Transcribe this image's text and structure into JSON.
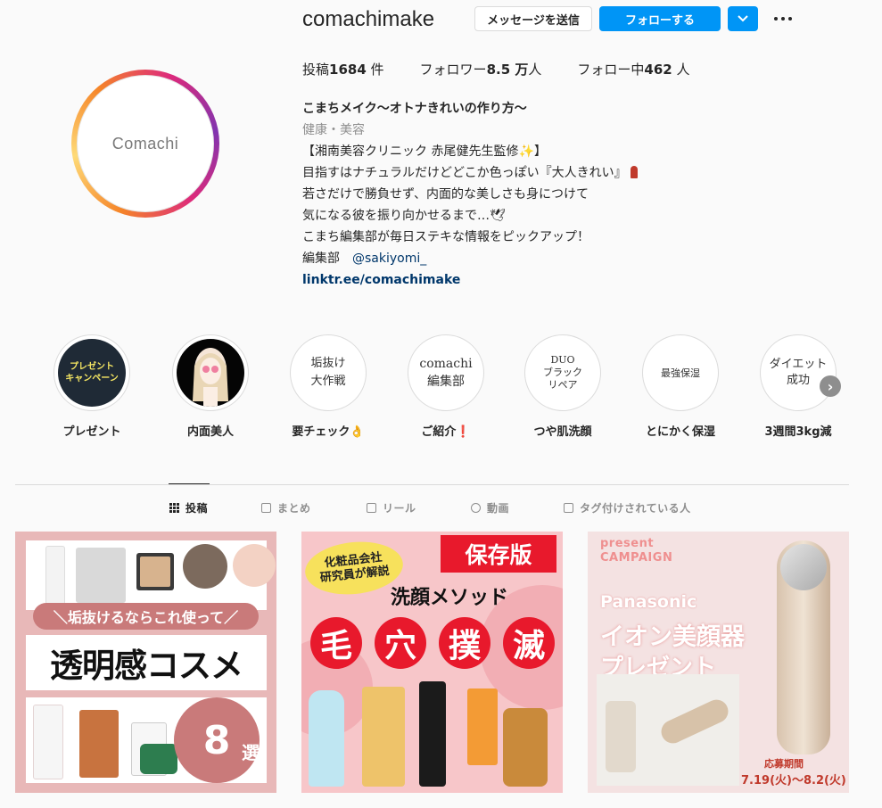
{
  "profile": {
    "username": "comachimake",
    "avatar_text": "Comachi",
    "message_button": "メッセージを送信",
    "follow_button": "フォローする",
    "stats": {
      "posts_label": "投稿",
      "posts_value": "1684",
      "posts_unit": " 件",
      "followers_label": "フォロワー",
      "followers_value": "8.5 万",
      "followers_unit": "人",
      "following_label": "フォロー中",
      "following_value": "462",
      "following_unit": " 人"
    },
    "bio": {
      "name": "こまちメイク〜オトナきれいの作り方〜",
      "category": "健康・美容",
      "line1": "【湘南美容クリニック 赤尾健先生監修",
      "line1_end": "】",
      "line2": "目指すはナチュラルだけどどこか色っぽい『大人きれい』",
      "line3": "若さだけで勝負せず、内面的な美しさも身につけて",
      "line4": "気になる彼を振り向かせるまで…🕊",
      "line5": "こまち編集部が毎日ステキな情報をピックアップ！",
      "line6_prefix": "編集部",
      "mention": "@sakiyomi_",
      "link": "linktr.ee/comachimake"
    }
  },
  "highlights": [
    {
      "label": "プレゼント",
      "inner": "プレゼント\nキャンペーン"
    },
    {
      "label": "内面美人",
      "inner": ""
    },
    {
      "label": "要チェック👌",
      "inner": "垢抜け\n大作戦"
    },
    {
      "label": "ご紹介❗",
      "inner": "comachi\n編集部"
    },
    {
      "label": "つや肌洗顔",
      "inner": "DUO\nブラック\nリペア"
    },
    {
      "label": "とにかく保湿",
      "inner": "最強保湿"
    },
    {
      "label": "3週間3kg減",
      "inner": "ダイエット\n成功"
    }
  ],
  "tabs": [
    {
      "label": "投稿",
      "icon": "grid-icon"
    },
    {
      "label": "まとめ",
      "icon": "guide-icon"
    },
    {
      "label": "リール",
      "icon": "reels-icon"
    },
    {
      "label": "動画",
      "icon": "video-icon"
    },
    {
      "label": "タグ付けされている人",
      "icon": "tagged-icon"
    }
  ],
  "posts": {
    "p1": {
      "banner": "＼垢抜けるならこれ使って／",
      "title": "透明感コスメ",
      "count": "8",
      "count_unit": "選"
    },
    "p2": {
      "tag": "化粧品会社\n研究員が解説",
      "save": "保存版",
      "subtitle": "洗顔メソッド",
      "big": [
        "毛",
        "穴",
        "撲",
        "滅"
      ]
    },
    "p3": {
      "present": "present",
      "campaign": "CAMPAIGN",
      "brand": "Panasonic",
      "product": "イオン美顔器",
      "gift": "プレゼント",
      "period_label": "応募期間",
      "dates": "7.19(火)〜8.2(火)"
    }
  },
  "colors": {
    "follow_blue": "#0095f6",
    "link_blue": "#00376b",
    "save_red": "#e8192c"
  }
}
